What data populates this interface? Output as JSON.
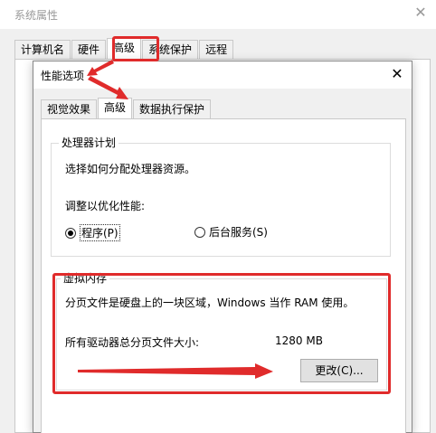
{
  "outer_window": {
    "title": "系统属性",
    "tabs": [
      {
        "label": "计算机名",
        "active": false
      },
      {
        "label": "硬件",
        "active": false
      },
      {
        "label": "高级",
        "active": true
      },
      {
        "label": "系统保护",
        "active": false
      },
      {
        "label": "远程",
        "active": false
      }
    ]
  },
  "dialog": {
    "title": "性能选项",
    "tabs": [
      {
        "label": "视觉效果",
        "active": false
      },
      {
        "label": "高级",
        "active": true
      },
      {
        "label": "数据执行保护",
        "active": false
      }
    ],
    "processor": {
      "legend": "处理器计划",
      "description": "选择如何分配处理器资源。",
      "adjust_label": "调整以优化性能:",
      "options": [
        {
          "label": "程序(P)",
          "checked": true
        },
        {
          "label": "后台服务(S)",
          "checked": false
        }
      ]
    },
    "virtual_memory": {
      "legend": "虚拟内存",
      "description": "分页文件是硬盘上的一块区域，Windows 当作 RAM 使用。",
      "total_label": "所有驱动器总分页文件大小:",
      "total_value": "1280 MB",
      "change_button": "更改(C)..."
    }
  },
  "colors": {
    "annotation": "#e02b2b",
    "window_bg": "#f0f0f0",
    "panel_bg": "#ffffff"
  }
}
